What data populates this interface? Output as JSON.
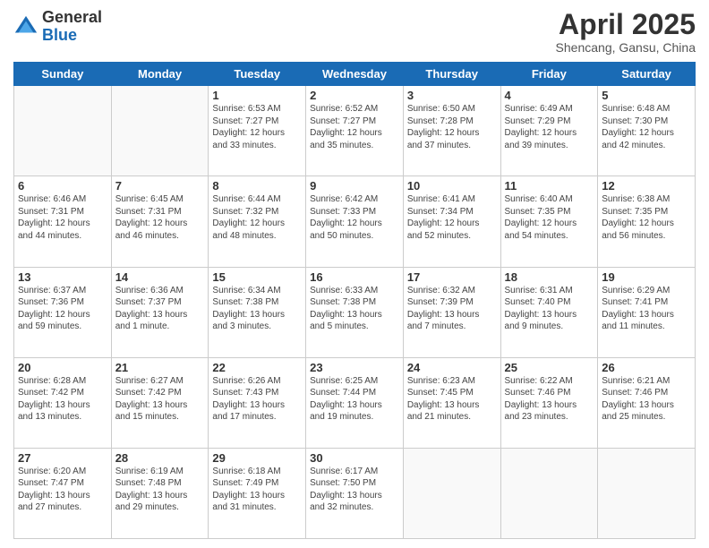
{
  "header": {
    "logo": {
      "general": "General",
      "blue": "Blue"
    },
    "title": "April 2025",
    "location": "Shencang, Gansu, China"
  },
  "weekdays": [
    "Sunday",
    "Monday",
    "Tuesday",
    "Wednesday",
    "Thursday",
    "Friday",
    "Saturday"
  ],
  "weeks": [
    [
      {
        "day": "",
        "sunrise": "",
        "sunset": "",
        "daylight": ""
      },
      {
        "day": "",
        "sunrise": "",
        "sunset": "",
        "daylight": ""
      },
      {
        "day": "1",
        "sunrise": "Sunrise: 6:53 AM",
        "sunset": "Sunset: 7:27 PM",
        "daylight": "Daylight: 12 hours and 33 minutes."
      },
      {
        "day": "2",
        "sunrise": "Sunrise: 6:52 AM",
        "sunset": "Sunset: 7:27 PM",
        "daylight": "Daylight: 12 hours and 35 minutes."
      },
      {
        "day": "3",
        "sunrise": "Sunrise: 6:50 AM",
        "sunset": "Sunset: 7:28 PM",
        "daylight": "Daylight: 12 hours and 37 minutes."
      },
      {
        "day": "4",
        "sunrise": "Sunrise: 6:49 AM",
        "sunset": "Sunset: 7:29 PM",
        "daylight": "Daylight: 12 hours and 39 minutes."
      },
      {
        "day": "5",
        "sunrise": "Sunrise: 6:48 AM",
        "sunset": "Sunset: 7:30 PM",
        "daylight": "Daylight: 12 hours and 42 minutes."
      }
    ],
    [
      {
        "day": "6",
        "sunrise": "Sunrise: 6:46 AM",
        "sunset": "Sunset: 7:31 PM",
        "daylight": "Daylight: 12 hours and 44 minutes."
      },
      {
        "day": "7",
        "sunrise": "Sunrise: 6:45 AM",
        "sunset": "Sunset: 7:31 PM",
        "daylight": "Daylight: 12 hours and 46 minutes."
      },
      {
        "day": "8",
        "sunrise": "Sunrise: 6:44 AM",
        "sunset": "Sunset: 7:32 PM",
        "daylight": "Daylight: 12 hours and 48 minutes."
      },
      {
        "day": "9",
        "sunrise": "Sunrise: 6:42 AM",
        "sunset": "Sunset: 7:33 PM",
        "daylight": "Daylight: 12 hours and 50 minutes."
      },
      {
        "day": "10",
        "sunrise": "Sunrise: 6:41 AM",
        "sunset": "Sunset: 7:34 PM",
        "daylight": "Daylight: 12 hours and 52 minutes."
      },
      {
        "day": "11",
        "sunrise": "Sunrise: 6:40 AM",
        "sunset": "Sunset: 7:35 PM",
        "daylight": "Daylight: 12 hours and 54 minutes."
      },
      {
        "day": "12",
        "sunrise": "Sunrise: 6:38 AM",
        "sunset": "Sunset: 7:35 PM",
        "daylight": "Daylight: 12 hours and 56 minutes."
      }
    ],
    [
      {
        "day": "13",
        "sunrise": "Sunrise: 6:37 AM",
        "sunset": "Sunset: 7:36 PM",
        "daylight": "Daylight: 12 hours and 59 minutes."
      },
      {
        "day": "14",
        "sunrise": "Sunrise: 6:36 AM",
        "sunset": "Sunset: 7:37 PM",
        "daylight": "Daylight: 13 hours and 1 minute."
      },
      {
        "day": "15",
        "sunrise": "Sunrise: 6:34 AM",
        "sunset": "Sunset: 7:38 PM",
        "daylight": "Daylight: 13 hours and 3 minutes."
      },
      {
        "day": "16",
        "sunrise": "Sunrise: 6:33 AM",
        "sunset": "Sunset: 7:38 PM",
        "daylight": "Daylight: 13 hours and 5 minutes."
      },
      {
        "day": "17",
        "sunrise": "Sunrise: 6:32 AM",
        "sunset": "Sunset: 7:39 PM",
        "daylight": "Daylight: 13 hours and 7 minutes."
      },
      {
        "day": "18",
        "sunrise": "Sunrise: 6:31 AM",
        "sunset": "Sunset: 7:40 PM",
        "daylight": "Daylight: 13 hours and 9 minutes."
      },
      {
        "day": "19",
        "sunrise": "Sunrise: 6:29 AM",
        "sunset": "Sunset: 7:41 PM",
        "daylight": "Daylight: 13 hours and 11 minutes."
      }
    ],
    [
      {
        "day": "20",
        "sunrise": "Sunrise: 6:28 AM",
        "sunset": "Sunset: 7:42 PM",
        "daylight": "Daylight: 13 hours and 13 minutes."
      },
      {
        "day": "21",
        "sunrise": "Sunrise: 6:27 AM",
        "sunset": "Sunset: 7:42 PM",
        "daylight": "Daylight: 13 hours and 15 minutes."
      },
      {
        "day": "22",
        "sunrise": "Sunrise: 6:26 AM",
        "sunset": "Sunset: 7:43 PM",
        "daylight": "Daylight: 13 hours and 17 minutes."
      },
      {
        "day": "23",
        "sunrise": "Sunrise: 6:25 AM",
        "sunset": "Sunset: 7:44 PM",
        "daylight": "Daylight: 13 hours and 19 minutes."
      },
      {
        "day": "24",
        "sunrise": "Sunrise: 6:23 AM",
        "sunset": "Sunset: 7:45 PM",
        "daylight": "Daylight: 13 hours and 21 minutes."
      },
      {
        "day": "25",
        "sunrise": "Sunrise: 6:22 AM",
        "sunset": "Sunset: 7:46 PM",
        "daylight": "Daylight: 13 hours and 23 minutes."
      },
      {
        "day": "26",
        "sunrise": "Sunrise: 6:21 AM",
        "sunset": "Sunset: 7:46 PM",
        "daylight": "Daylight: 13 hours and 25 minutes."
      }
    ],
    [
      {
        "day": "27",
        "sunrise": "Sunrise: 6:20 AM",
        "sunset": "Sunset: 7:47 PM",
        "daylight": "Daylight: 13 hours and 27 minutes."
      },
      {
        "day": "28",
        "sunrise": "Sunrise: 6:19 AM",
        "sunset": "Sunset: 7:48 PM",
        "daylight": "Daylight: 13 hours and 29 minutes."
      },
      {
        "day": "29",
        "sunrise": "Sunrise: 6:18 AM",
        "sunset": "Sunset: 7:49 PM",
        "daylight": "Daylight: 13 hours and 31 minutes."
      },
      {
        "day": "30",
        "sunrise": "Sunrise: 6:17 AM",
        "sunset": "Sunset: 7:50 PM",
        "daylight": "Daylight: 13 hours and 32 minutes."
      },
      {
        "day": "",
        "sunrise": "",
        "sunset": "",
        "daylight": ""
      },
      {
        "day": "",
        "sunrise": "",
        "sunset": "",
        "daylight": ""
      },
      {
        "day": "",
        "sunrise": "",
        "sunset": "",
        "daylight": ""
      }
    ]
  ]
}
